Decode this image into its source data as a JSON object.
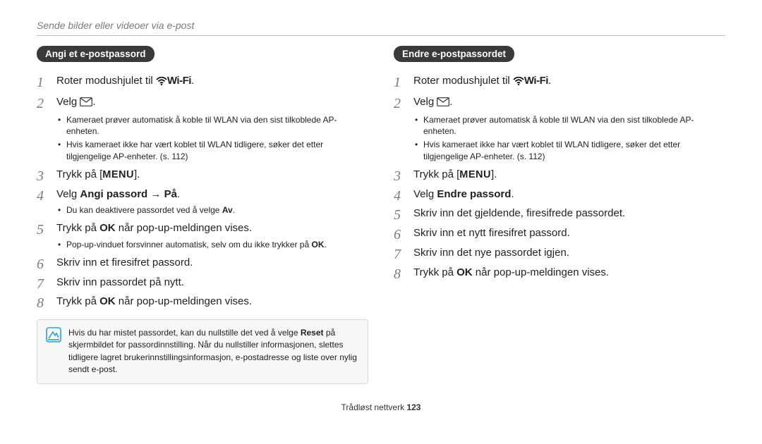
{
  "header": {
    "title": "Sende bilder eller videoer via e-post"
  },
  "left": {
    "section_title": "Angi et e-postpassord",
    "steps": {
      "s1_a": "Roter modushjulet til ",
      "s1_b": ".",
      "wifi_label": "Wi-Fi",
      "s2_a": "Velg ",
      "s2_b": ".",
      "s2_bullets": [
        "Kameraet prøver automatisk å koble til WLAN via den sist tilkoblede AP-enheten.",
        "Hvis kameraet ikke har vært koblet til WLAN tidligere, søker det etter tilgjengelige AP-enheter. (s. 112)"
      ],
      "s3_a": "Trykk på [",
      "menu_label": "MENU",
      "s3_b": "].",
      "s4_a": "Velg ",
      "s4_bold": "Angi passord",
      "s4_arrow": " → ",
      "s4_bold2": "På",
      "s4_b": ".",
      "s4_bullets": [
        {
          "pre": "Du kan deaktivere passordet ved å velge ",
          "bold": "Av",
          "post": "."
        }
      ],
      "s5_a": "Trykk på ",
      "s5_bold": "OK",
      "s5_b": " når pop-up-meldingen vises.",
      "s5_bullets": [
        {
          "pre": "Pop-up-vinduet forsvinner automatisk, selv om du ikke trykker på ",
          "bold": "OK",
          "post": "."
        }
      ],
      "s6": "Skriv inn et firesifret passord.",
      "s7": "Skriv inn passordet på nytt.",
      "s8_a": "Trykk på ",
      "s8_bold": "OK",
      "s8_b": " når pop-up-meldingen vises."
    },
    "note": {
      "pre": "Hvis du har mistet passordet, kan du nullstille det ved å velge ",
      "bold": "Reset",
      "post": " på skjermbildet for passordinnstilling. Når du nullstiller informasjonen, slettes tidligere lagret brukerinnstillingsinformasjon, e-postadresse og liste over nylig sendt e-post."
    }
  },
  "right": {
    "section_title": "Endre e-postpassordet",
    "steps": {
      "s1_a": "Roter modushjulet til ",
      "s1_b": ".",
      "wifi_label": "Wi-Fi",
      "s2_a": "Velg ",
      "s2_b": ".",
      "s2_bullets": [
        "Kameraet prøver automatisk å koble til WLAN via den sist tilkoblede AP-enheten.",
        "Hvis kameraet ikke har vært koblet til WLAN tidligere, søker det etter tilgjengelige AP-enheter. (s. 112)"
      ],
      "s3_a": "Trykk på [",
      "menu_label": "MENU",
      "s3_b": "].",
      "s4_a": "Velg ",
      "s4_bold": "Endre passord",
      "s4_b": ".",
      "s5": "Skriv inn det gjeldende, firesifrede passordet.",
      "s6": "Skriv inn et nytt firesifret passord.",
      "s7": "Skriv inn det nye passordet igjen.",
      "s8_a": "Trykk på ",
      "s8_bold": "OK",
      "s8_b": " når pop-up-meldingen vises."
    }
  },
  "footer": {
    "label": "Trådløst nettverk  ",
    "page": "123"
  }
}
